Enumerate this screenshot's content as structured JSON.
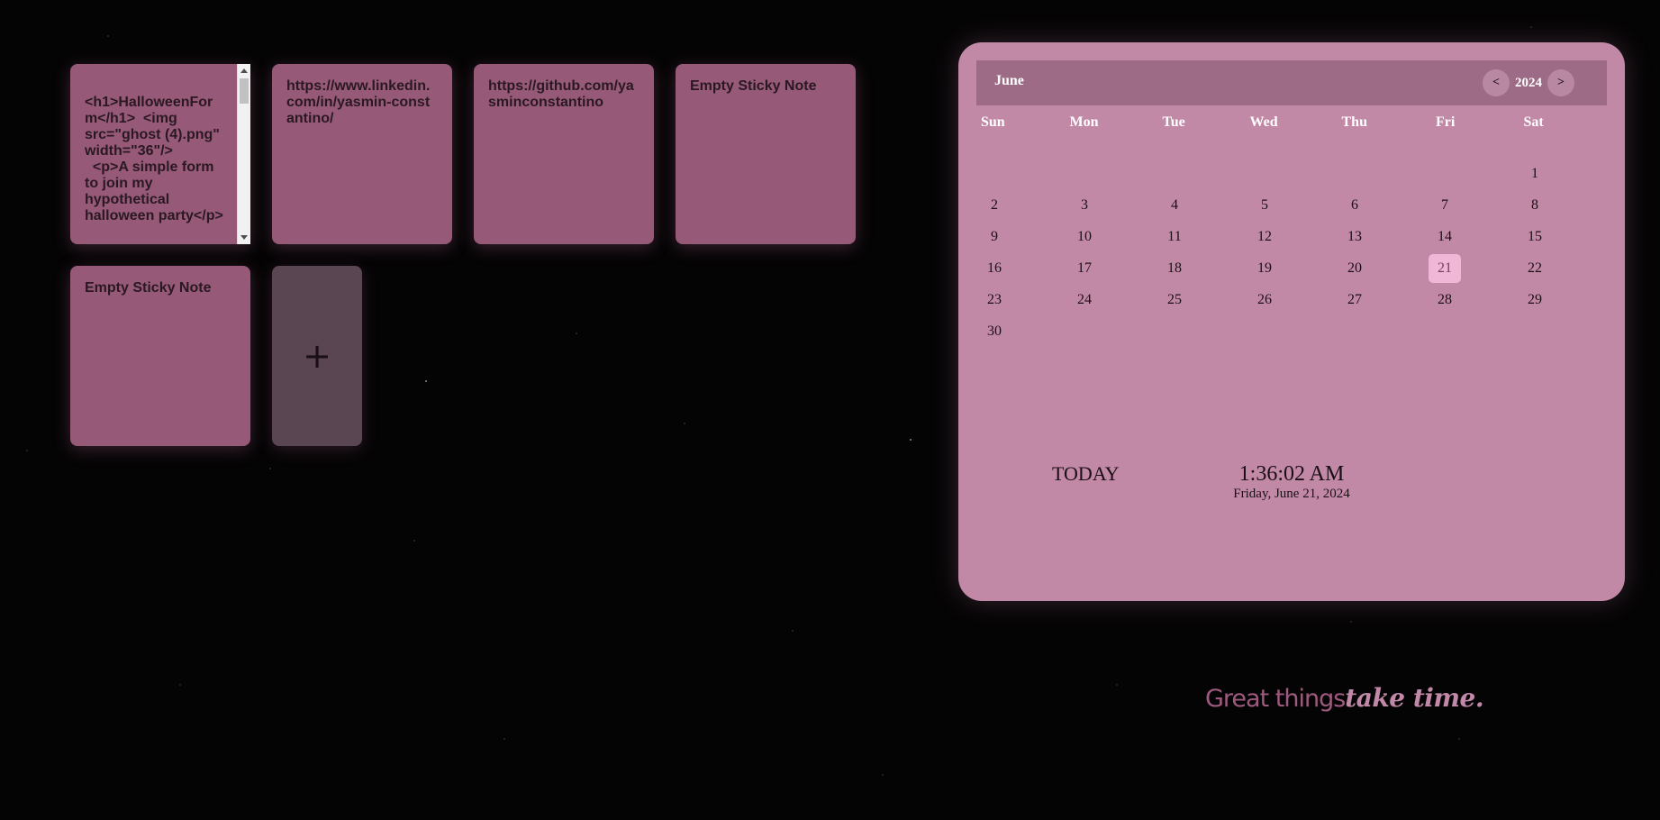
{
  "notes": [
    {
      "text": "<h1>HalloweenForm</h1>  <img src=\"ghost (4).png\" width=\"36\"/>\n  <p>A simple form to join my hypothetical halloween party</p>"
    },
    {
      "text": "https://www.linkedin.com/in/yasmin-constantino/"
    },
    {
      "text": "https://github.com/yasminconstantino"
    },
    {
      "text": "Empty Sticky Note"
    },
    {
      "text": "Empty Sticky Note"
    }
  ],
  "add_note": {
    "icon": "plus-icon",
    "label": "+"
  },
  "calendar": {
    "month": "June",
    "year": "2024",
    "prev_label": "<",
    "next_label": ">",
    "weekdays": [
      "Sun",
      "Mon",
      "Tue",
      "Wed",
      "Thu",
      "Fri",
      "Sat"
    ],
    "selected_day": "21",
    "weeks": [
      [
        "",
        "",
        "",
        "",
        "",
        "",
        "1"
      ],
      [
        "2",
        "3",
        "4",
        "5",
        "6",
        "7",
        "8"
      ],
      [
        "9",
        "10",
        "11",
        "12",
        "13",
        "14",
        "15"
      ],
      [
        "16",
        "17",
        "18",
        "19",
        "20",
        "21",
        "22"
      ],
      [
        "23",
        "24",
        "25",
        "26",
        "27",
        "28",
        "29"
      ],
      [
        "30",
        "",
        "",
        "",
        "",
        "",
        ""
      ]
    ]
  },
  "today": {
    "label": "TODAY",
    "time": "1:36:02 AM",
    "date": "Friday, June 21, 2024"
  },
  "tagline": {
    "part1": "Great things",
    "part2": "take time."
  },
  "colors": {
    "background": "#050405",
    "note": "#965a78",
    "calendar": "#c289a7",
    "calendar_header": "#9d6b86",
    "today_highlight": "#f0b7d6"
  }
}
